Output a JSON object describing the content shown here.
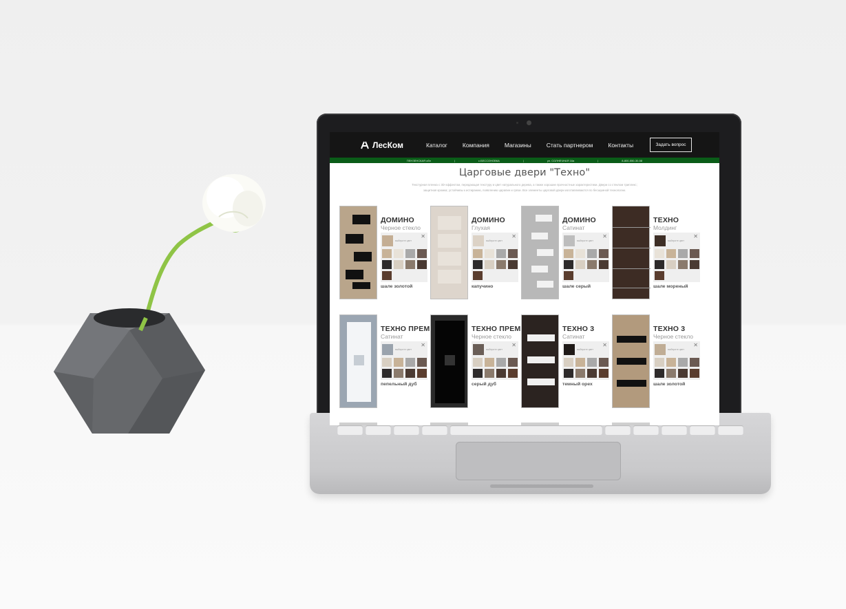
{
  "header": {
    "logo_text": "ЛесКом",
    "nav": [
      "Каталог",
      "Компания",
      "Магазины",
      "Стать партнером",
      "Контакты"
    ],
    "ask_button": "Задать вопрос"
  },
  "info_strip": [
    "ПЕНЗЕНСКАЯ обл",
    "|",
    "с.БЕССОНОВКА",
    "|",
    "ул. СОЛНЕЧНАЯ 16а",
    "|",
    "8-800-550-30-58"
  ],
  "page": {
    "title": "Царговые двери \"Техно\"",
    "intro": "Текстурная пленка с 3D-эффектом, передающая текстуру и цвет натурального дерева, а также хорошие прочностные характеристики. Двери со стеклом триплекс; защитная кромка; устойчивы к истиранию, появлению царапин и грязи. Все элементы царговой двери изготавливаются по бесшумной технологии."
  },
  "cards": [
    {
      "model": "ДОМИНО",
      "sub": "Черное стекло",
      "chosen_label": "выберите цвет",
      "color_name": "шале золотой"
    },
    {
      "model": "ДОМИНО",
      "sub": "Глухая",
      "chosen_label": "выберите цвет",
      "color_name": "капучино"
    },
    {
      "model": "ДОМИНО",
      "sub": "Сатинат",
      "chosen_label": "выберите цвет",
      "color_name": "шале серый"
    },
    {
      "model": "ТЕХНО",
      "sub": "Молдинг",
      "chosen_label": "выберите цвет",
      "color_name": "шале мореный"
    },
    {
      "model": "ТЕХНО ПРЕМИУМ",
      "sub": "Сатинат",
      "chosen_label": "выберите цвет",
      "color_name": "пепельный дуб"
    },
    {
      "model": "ТЕХНО ПРЕМИУМ",
      "sub": "Черное стекло",
      "chosen_label": "выберите цвет",
      "color_name": "серый дуб"
    },
    {
      "model": "ТЕХНО 3",
      "sub": "Сатинат",
      "chosen_label": "выберите цвет",
      "color_name": "темный орех"
    },
    {
      "model": "ТЕХНО 3",
      "sub": "Черное стекло",
      "chosen_label": "выберите цвет",
      "color_name": "шале золотой"
    }
  ],
  "colors": {
    "header_bg": "#151515",
    "strip_bg": "#0a5c18",
    "swatches": [
      "#c8b398",
      "#e8e2d8",
      "#a9a9a9",
      "#6b5a52",
      "#2d2a2a",
      "#8a7a6c",
      "#7d6a5a",
      "#4a3a32",
      "#5a3d2e"
    ]
  }
}
